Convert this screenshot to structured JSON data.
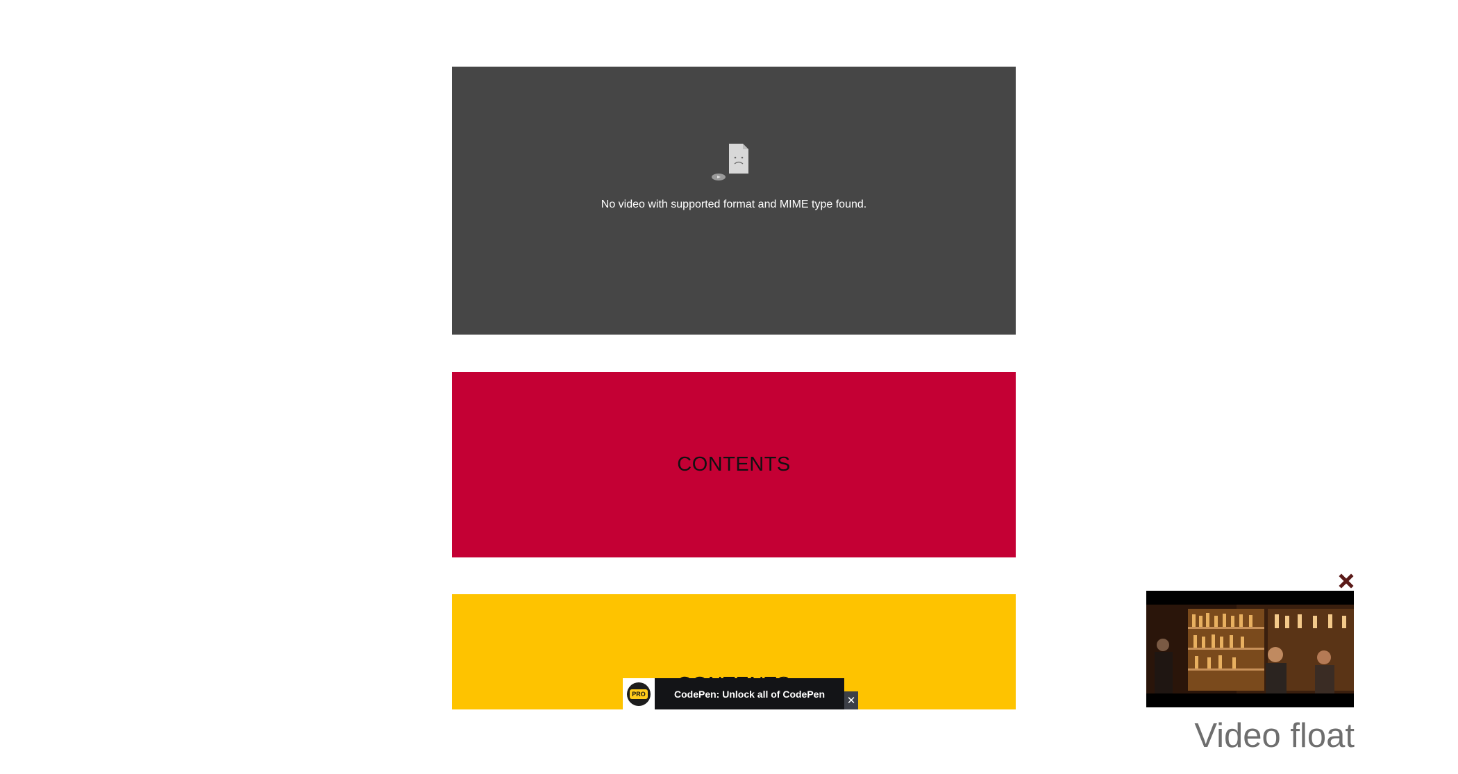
{
  "video": {
    "error_message": "No video with supported format and MIME type found."
  },
  "blocks": [
    {
      "label": "CONTENTS",
      "color": "#c40034"
    },
    {
      "label": "CONTENTS",
      "color": "#fec300"
    }
  ],
  "promo": {
    "badge": "PRO",
    "text": "CodePen: Unlock all of CodePen",
    "close_glyph": "✕"
  },
  "float": {
    "caption": "Video float",
    "close_icon": "close-x-icon",
    "close_color": "#5a1a18"
  },
  "colors": {
    "video_bg": "#464646",
    "red": "#c40034",
    "yellow": "#fec300"
  }
}
